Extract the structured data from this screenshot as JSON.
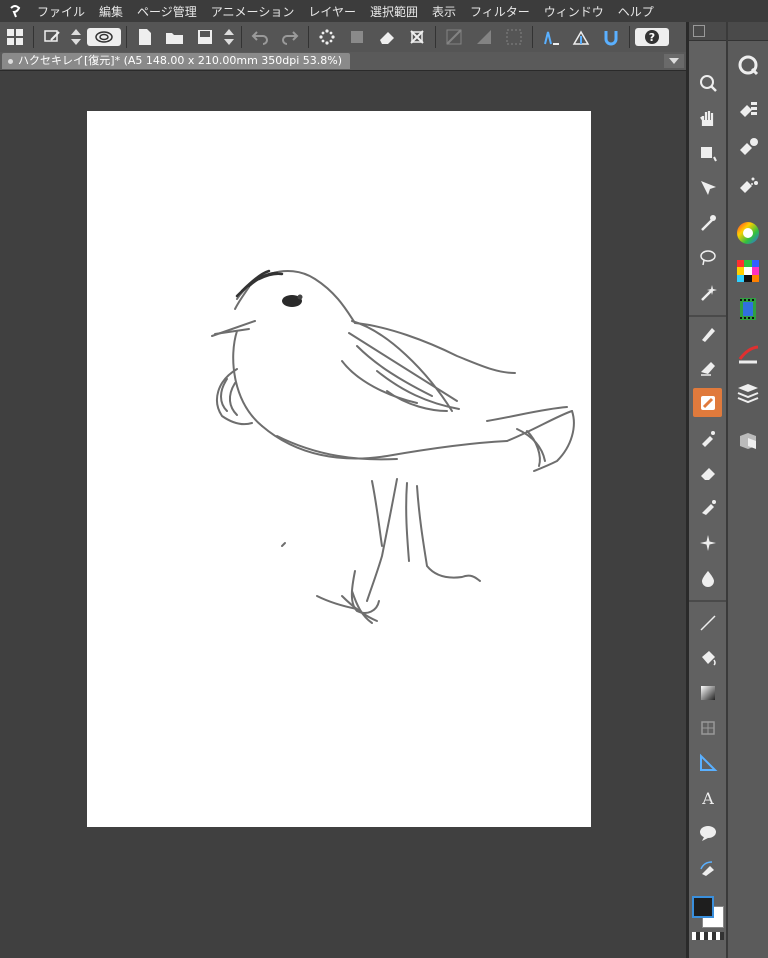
{
  "menubar": {
    "items": [
      "ファイル",
      "編集",
      "ページ管理",
      "アニメーション",
      "レイヤー",
      "選択範囲",
      "表示",
      "フィルター",
      "ウィンドウ",
      "ヘルプ"
    ]
  },
  "document_tab": {
    "title": "ハクセキレイ[復元]* (A5 148.00 x 210.00mm 350dpi 53.8%)"
  },
  "toolbar": {
    "icons": [
      "grid-view-icon",
      "edit-icon",
      "arrow-up-down-icon",
      "spiral-logo-icon",
      "new-file-icon",
      "open-folder-icon",
      "save-icon",
      "arrow-up-down-icon",
      "undo-icon",
      "redo-icon",
      "transform-dots-icon",
      "fill-clear-icon",
      "eraser-icon",
      "crop-icon",
      "ruler-diag-icon",
      "ruler-fill-icon",
      "grid-icon",
      "pen-ruler-icon",
      "perspective-icon",
      "magnet-icon",
      "help-icon"
    ]
  },
  "tools": [
    "zoom",
    "hand",
    "rotate",
    "move",
    "eyedropper",
    "lasso",
    "magic-wand",
    "pen",
    "pencil",
    "brush",
    "airbrush",
    "eraser",
    "blend",
    "sparkle",
    "water-drop",
    "line",
    "bucket",
    "gradient",
    "frame",
    "ruler",
    "text",
    "balloon",
    "correct-line"
  ],
  "colors": {
    "accent": "#e07a3c",
    "main_color": "#1e1e1e",
    "sub_color": "#ffffff"
  }
}
